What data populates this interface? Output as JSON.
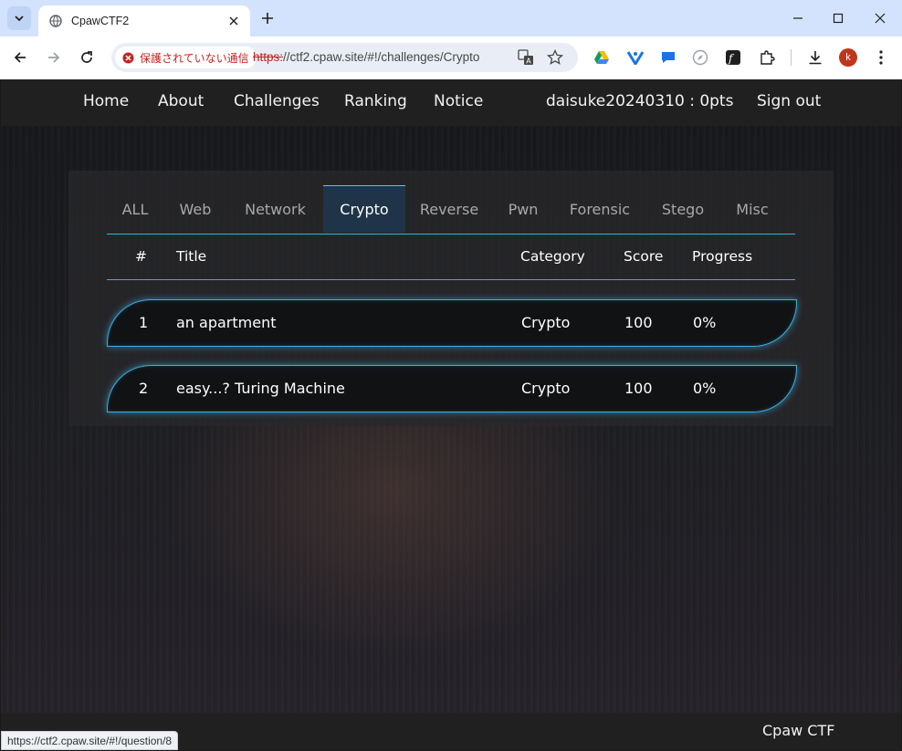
{
  "browser": {
    "tab": {
      "title": "CpawCTF2"
    },
    "security_chip": "保護されていない通信",
    "url_scheme": "https:",
    "url_rest": "//ctf2.cpaw.site/#!/challenges/Crypto",
    "profile_initial": "k",
    "status_url": "https://ctf2.cpaw.site/#!/question/8",
    "colors": {
      "tabbar": "#d3e3fd",
      "warning": "#c5221f",
      "avatar": "#c1351d"
    }
  },
  "nav": {
    "home": "Home",
    "about": "About",
    "challenges": "Challenges",
    "ranking": "Ranking",
    "notice": "Notice",
    "user": "daisuke20240310 : 0pts",
    "signout": "Sign out"
  },
  "categories": [
    "ALL",
    "Web",
    "Network",
    "Crypto",
    "Reverse",
    "Pwn",
    "Forensic",
    "Stego",
    "Misc"
  ],
  "active_category": "Crypto",
  "table": {
    "headers": {
      "num": "#",
      "title": "Title",
      "category": "Category",
      "score": "Score",
      "progress": "Progress"
    },
    "rows": [
      {
        "num": "1",
        "title": "an apartment",
        "category": "Crypto",
        "score": "100",
        "progress": "0%"
      },
      {
        "num": "2",
        "title": "easy...? Turing Machine",
        "category": "Crypto",
        "score": "100",
        "progress": "0%"
      }
    ]
  },
  "footer": {
    "brand": "Cpaw CTF"
  },
  "theme": {
    "accent": "#3ab0dc",
    "active_tab_bg": "#1f3448",
    "navbar": "#202020"
  }
}
